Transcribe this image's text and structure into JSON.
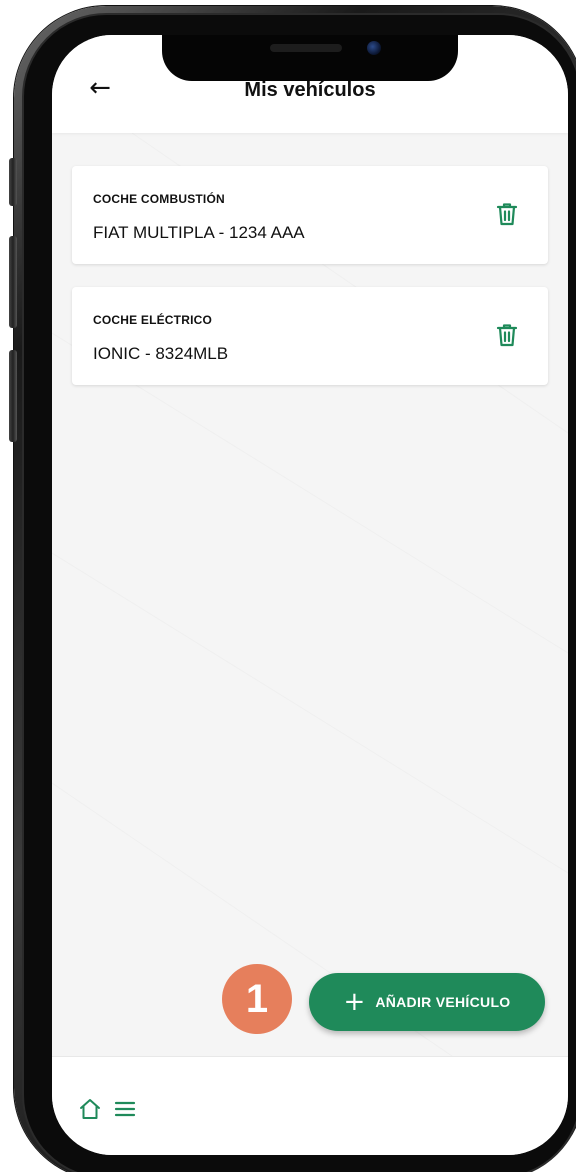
{
  "header": {
    "title": "Mis vehículos",
    "back_icon": "arrow-left-icon"
  },
  "vehicles": [
    {
      "type": "COCHE COMBUSTIÓN",
      "name": "FIAT MULTIPLA - 1234 AAA",
      "icon": "trash-icon"
    },
    {
      "type": "COCHE ELÉCTRICO",
      "name": "IONIC - 8324MLB",
      "icon": "trash-icon"
    }
  ],
  "fab": {
    "icon": "plus-icon",
    "label": "AÑADIR VEHÍCULO"
  },
  "step_badge": "1",
  "bottom_nav": {
    "items": [
      "home-icon",
      "menu-icon"
    ]
  },
  "colors": {
    "accent": "#1f8a5a",
    "badge": "#e67f5c",
    "background": "#f5f5f5"
  }
}
